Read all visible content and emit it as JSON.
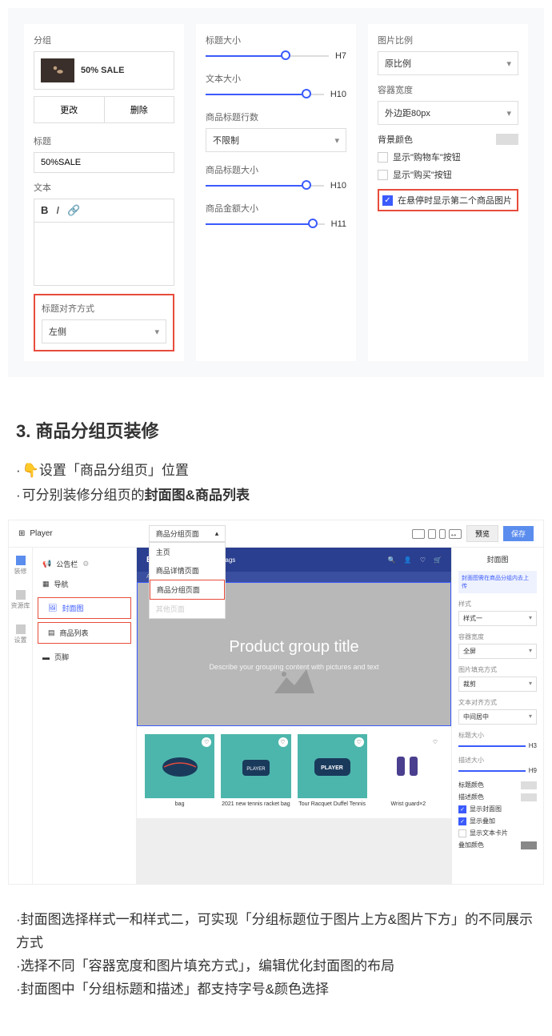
{
  "panel1": {
    "group_label": "分组",
    "sale_badge": "50% SALE",
    "change_btn": "更改",
    "delete_btn": "删除",
    "title_label": "标题",
    "title_value": "50%SALE",
    "text_label": "文本",
    "align_label": "标题对齐方式",
    "align_value": "左侧"
  },
  "panel2": {
    "title_size_label": "标题大小",
    "title_size_val": "H7",
    "text_size_label": "文本大小",
    "text_size_val": "H10",
    "title_lines_label": "商品标题行数",
    "title_lines_val": "不限制",
    "product_title_size_label": "商品标题大小",
    "product_title_size_val": "H10",
    "product_price_size_label": "商品金额大小",
    "product_price_size_val": "H11"
  },
  "panel3": {
    "ratio_label": "图片比例",
    "ratio_val": "原比例",
    "width_label": "容器宽度",
    "width_val": "外边距80px",
    "bg_label": "背景颜色",
    "show_cart": "显示\"购物车\"按钮",
    "show_buy": "显示\"购买\"按钮",
    "hover_second": "在悬停时显示第二个商品图片"
  },
  "heading3": "3. 商品分组页装修",
  "bullets": {
    "b1": "设置「商品分组页」位置",
    "b2_pre": "可分别装修分组页的",
    "b2_bold": "封面图&商品列表"
  },
  "ss2": {
    "player": "Player",
    "page_select": "商品分组页面",
    "dropdown": {
      "home": "主页",
      "detail": "商品详情页面",
      "group": "商品分组页面",
      "other": "其他页面"
    },
    "preview": "预览",
    "save": "保存",
    "leftbar": {
      "decorate": "装修",
      "resource": "资源库",
      "settings": "设置"
    },
    "nav": {
      "announce": "公告栏",
      "navigation": "导航",
      "cover": "封面图",
      "products": "商品列表",
      "footer": "页脚"
    },
    "site_nav": {
      "all": "All pro",
      "tennis": "Tennis bags"
    },
    "hero": {
      "title": "Product group title",
      "desc": "Describe your grouping content with pictures and text"
    },
    "product_labels": {
      "p1": "bag",
      "p2": "2021 new tennis racket bag",
      "p3": "Tour Racquet Duffel Tennis",
      "p4": "Wrist guard×2"
    },
    "player_text": "PLAYER",
    "rp": {
      "title": "封面图",
      "notice": "封面图需在商品分组内去上传",
      "style_label": "样式",
      "style_val": "样式一",
      "width_label": "容器宽度",
      "width_val": "全屏",
      "fill_label": "图片填充方式",
      "fill_val": "裁剪",
      "align_label": "文本对齐方式",
      "align_val": "中间居中",
      "title_size_label": "标题大小",
      "title_size_val": "H3",
      "desc_size_label": "描述大小",
      "desc_size_val": "H9",
      "title_color": "标题颜色",
      "desc_color": "描述颜色",
      "show_cover": "显示封面图",
      "show_overlay": "显示叠加",
      "show_card": "显示文本卡片",
      "overlay_color": "叠加颜色"
    }
  },
  "article": {
    "p1": "封面图选择样式一和样式二，可实现「分组标题位于图片上方&图片下方」的不同展示方式",
    "p2": "选择不同「容器宽度和图片填充方式」，编辑优化封面图的布局",
    "p3": "封面图中「分组标题和描述」都支持字号&颜色选择"
  }
}
